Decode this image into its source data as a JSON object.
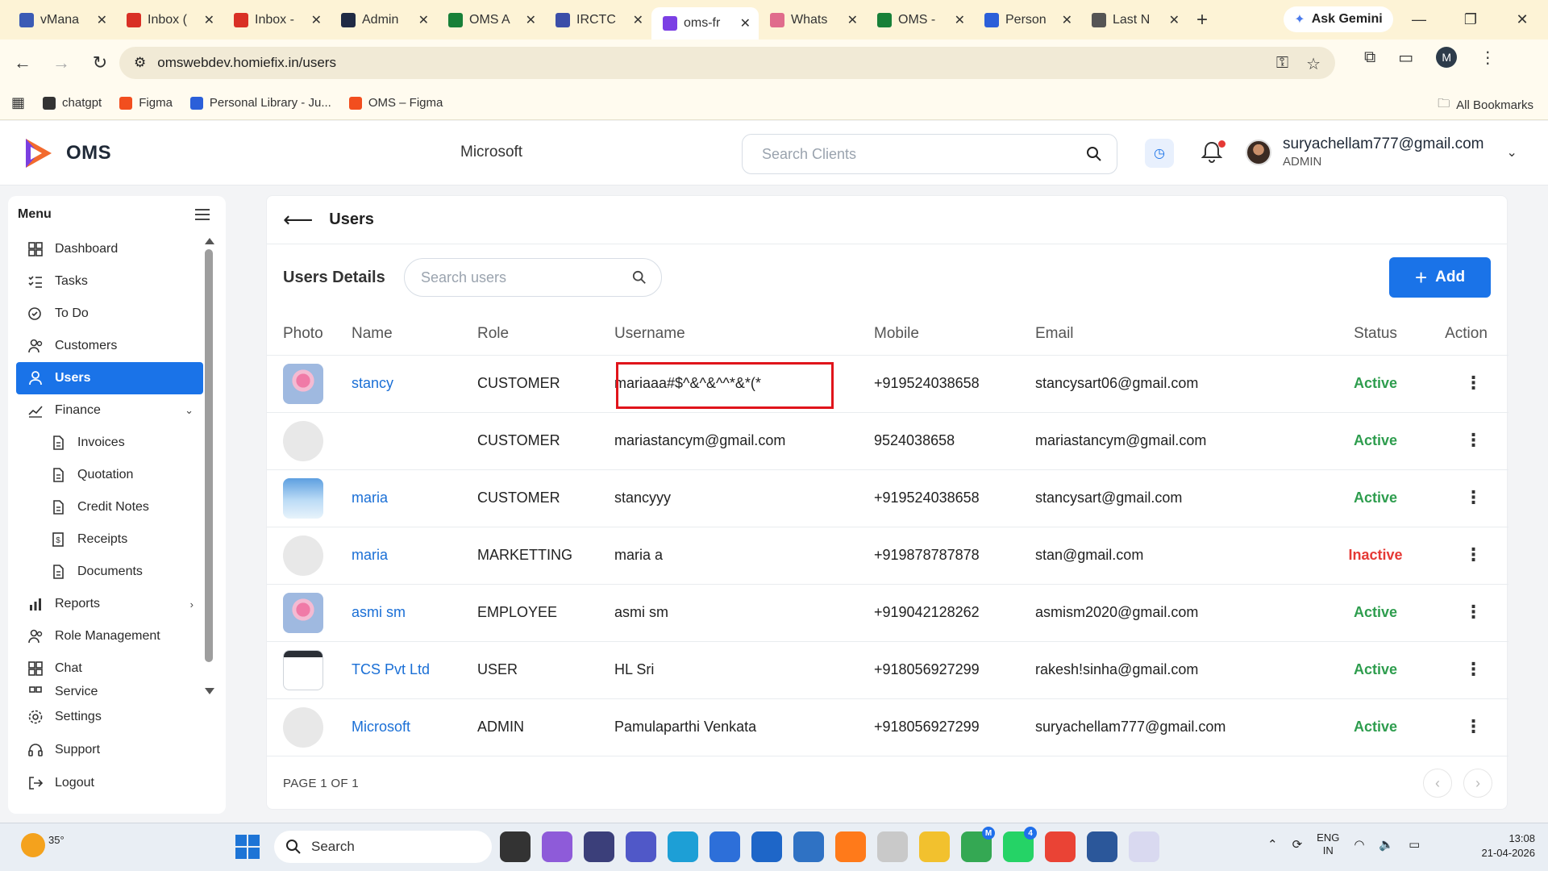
{
  "browser": {
    "tabs": [
      {
        "label": "vMana",
        "color": "#3b5bb5",
        "icon": "vmana-icon"
      },
      {
        "label": "Inbox (",
        "color": "#d93025",
        "icon": "gmail-icon"
      },
      {
        "label": "Inbox -",
        "color": "#d93025",
        "icon": "gmail-icon"
      },
      {
        "label": "Admin",
        "color": "#1f2a44",
        "icon": "admin-icon"
      },
      {
        "label": "OMS A",
        "color": "#188038",
        "icon": "sheets-icon"
      },
      {
        "label": "IRCTC",
        "color": "#3b4ea8",
        "icon": "irctc-icon"
      },
      {
        "label": "oms-fr",
        "color": "#7b3fe4",
        "icon": "vercel-icon"
      },
      {
        "label": "Whats",
        "color": "#e06c8c",
        "icon": "whatsapp-icon"
      },
      {
        "label": "OMS -",
        "color": "#188038",
        "icon": "sheets-icon"
      },
      {
        "label": "Person",
        "color": "#2b5fd9",
        "icon": "library-icon"
      },
      {
        "label": "Last N",
        "color": "#555555",
        "icon": "chatgpt-icon"
      }
    ],
    "active_tab_index": 6,
    "new_tab": "+",
    "ask_gemini": "Ask Gemini",
    "url": "omswebdev.homiefix.in/users",
    "profile_initial": "M",
    "bookmarks": [
      {
        "label": "chatgpt",
        "color": "#333333"
      },
      {
        "label": "Figma",
        "color": "#f24e1e"
      },
      {
        "label": "Personal Library - Ju...",
        "color": "#2b5fd9"
      },
      {
        "label": "OMS – Figma",
        "color": "#f24e1e"
      }
    ],
    "all_bookmarks": "All Bookmarks"
  },
  "header": {
    "app_name": "OMS",
    "company": "Microsoft",
    "search_placeholder": "Search Clients",
    "user_email": "suryachellam777@gmail.com",
    "user_role": "ADMIN"
  },
  "sidebar": {
    "title": "Menu",
    "items": [
      {
        "label": "Dashboard",
        "icon": "dashboard-icon"
      },
      {
        "label": "Tasks",
        "icon": "tasks-icon"
      },
      {
        "label": "To Do",
        "icon": "todo-icon"
      },
      {
        "label": "Customers",
        "icon": "customers-icon"
      },
      {
        "label": "Users",
        "icon": "user-icon",
        "active": true
      },
      {
        "label": "Finance",
        "icon": "finance-icon",
        "expanded": true
      },
      {
        "label": "Invoices",
        "icon": "document-icon",
        "sub": true
      },
      {
        "label": "Quotation",
        "icon": "document-icon",
        "sub": true
      },
      {
        "label": "Credit Notes",
        "icon": "document-icon",
        "sub": true
      },
      {
        "label": "Receipts",
        "icon": "receipt-icon",
        "sub": true
      },
      {
        "label": "Documents",
        "icon": "documents-icon",
        "sub": true
      },
      {
        "label": "Reports",
        "icon": "reports-icon"
      },
      {
        "label": "Role Management",
        "icon": "role-icon"
      },
      {
        "label": "Chat",
        "icon": "chat-icon"
      },
      {
        "label": "Service",
        "icon": "service-icon"
      }
    ],
    "bottom": [
      {
        "label": "Settings",
        "icon": "settings-icon"
      },
      {
        "label": "Support",
        "icon": "support-icon"
      },
      {
        "label": "Logout",
        "icon": "logout-icon"
      }
    ]
  },
  "main": {
    "title": "Users",
    "details_title": "Users Details",
    "search_placeholder": "Search users",
    "add_label": "Add",
    "columns": [
      "Photo",
      "Name",
      "Role",
      "Username",
      "Mobile",
      "Email",
      "Status",
      "Action"
    ],
    "rows": [
      {
        "photo": "tree",
        "name": "stancy",
        "role": "CUSTOMER",
        "username": "mariaaa#$^&^&^^*&*(*",
        "mobile": "+919524038658",
        "email": "stancysart06@gmail.com",
        "status": "Active"
      },
      {
        "photo": "blank",
        "name": "",
        "role": "CUSTOMER",
        "username": "mariastancym@gmail.com",
        "mobile": "9524038658",
        "email": "mariastancym@gmail.com",
        "status": "Active"
      },
      {
        "photo": "sky",
        "name": "maria",
        "role": "CUSTOMER",
        "username": "stancyyy",
        "mobile": "+919524038658",
        "email": "stancysart@gmail.com",
        "status": "Active"
      },
      {
        "photo": "blank",
        "name": "maria",
        "role": "MARKETTING",
        "username": "maria a",
        "mobile": "+919878787878",
        "email": "stan@gmail.com",
        "status": "Inactive"
      },
      {
        "photo": "tree",
        "name": "asmi sm",
        "role": "EMPLOYEE",
        "username": "asmi sm",
        "mobile": "+919042128262",
        "email": "asmism2020@gmail.com",
        "status": "Active"
      },
      {
        "photo": "doc",
        "name": "TCS Pvt Ltd",
        "role": "USER",
        "username": "HL Sri",
        "mobile": "+918056927299",
        "email": "rakesh!sinha@gmail.com",
        "status": "Active"
      },
      {
        "photo": "blank",
        "name": "Microsoft",
        "role": "ADMIN",
        "username": "Pamulaparthi Venkata",
        "mobile": "+918056927299",
        "email": "suryachellam777@gmail.com",
        "status": "Active"
      }
    ],
    "page_info": "PAGE 1 OF 1"
  },
  "taskbar": {
    "temperature": "35°",
    "search_label": "Search",
    "language": "ENG",
    "region": "IN",
    "time": "13:08",
    "date": "21-04-2026",
    "whatsapp_badge": "4",
    "profile_badge": "M"
  }
}
